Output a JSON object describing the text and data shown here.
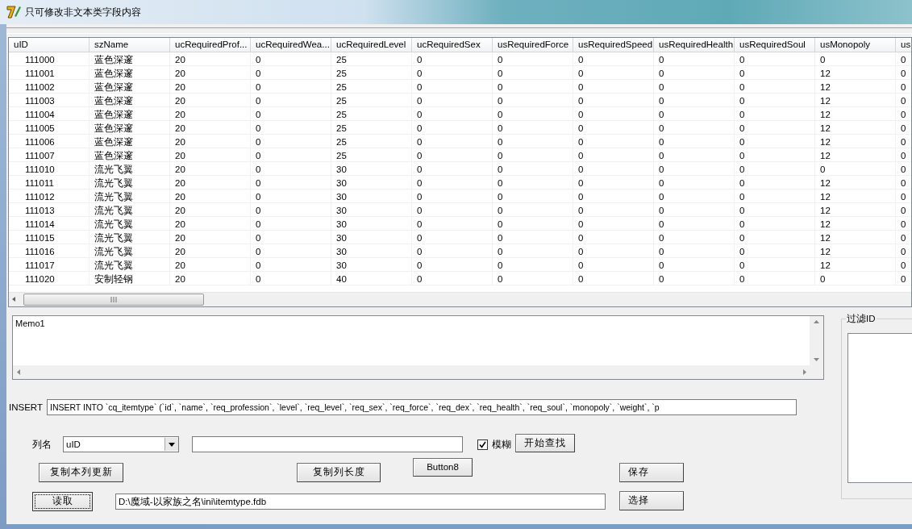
{
  "window": {
    "title": "只可修改非文本类字段内容"
  },
  "table": {
    "columns": [
      "uID",
      "szName",
      "ucRequiredProf...",
      "ucRequiredWea...",
      "ucRequiredLevel",
      "ucRequiredSex",
      "usRequiredForce",
      "usRequiredSpeed",
      "usRequiredHealth",
      "usRequiredSoul",
      "usMonopoly",
      "us"
    ],
    "rows": [
      [
        "111000",
        "蓝色深邃",
        "20",
        "0",
        "25",
        "0",
        "0",
        "0",
        "0",
        "0",
        "0",
        "0"
      ],
      [
        "111001",
        "蓝色深邃",
        "20",
        "0",
        "25",
        "0",
        "0",
        "0",
        "0",
        "0",
        "12",
        "0"
      ],
      [
        "111002",
        "蓝色深邃",
        "20",
        "0",
        "25",
        "0",
        "0",
        "0",
        "0",
        "0",
        "12",
        "0"
      ],
      [
        "111003",
        "蓝色深邃",
        "20",
        "0",
        "25",
        "0",
        "0",
        "0",
        "0",
        "0",
        "12",
        "0"
      ],
      [
        "111004",
        "蓝色深邃",
        "20",
        "0",
        "25",
        "0",
        "0",
        "0",
        "0",
        "0",
        "12",
        "0"
      ],
      [
        "111005",
        "蓝色深邃",
        "20",
        "0",
        "25",
        "0",
        "0",
        "0",
        "0",
        "0",
        "12",
        "0"
      ],
      [
        "111006",
        "蓝色深邃",
        "20",
        "0",
        "25",
        "0",
        "0",
        "0",
        "0",
        "0",
        "12",
        "0"
      ],
      [
        "111007",
        "蓝色深邃",
        "20",
        "0",
        "25",
        "0",
        "0",
        "0",
        "0",
        "0",
        "12",
        "0"
      ],
      [
        "111010",
        "流光飞翼",
        "20",
        "0",
        "30",
        "0",
        "0",
        "0",
        "0",
        "0",
        "0",
        "0"
      ],
      [
        "111011",
        "流光飞翼",
        "20",
        "0",
        "30",
        "0",
        "0",
        "0",
        "0",
        "0",
        "12",
        "0"
      ],
      [
        "111012",
        "流光飞翼",
        "20",
        "0",
        "30",
        "0",
        "0",
        "0",
        "0",
        "0",
        "12",
        "0"
      ],
      [
        "111013",
        "流光飞翼",
        "20",
        "0",
        "30",
        "0",
        "0",
        "0",
        "0",
        "0",
        "12",
        "0"
      ],
      [
        "111014",
        "流光飞翼",
        "20",
        "0",
        "30",
        "0",
        "0",
        "0",
        "0",
        "0",
        "12",
        "0"
      ],
      [
        "111015",
        "流光飞翼",
        "20",
        "0",
        "30",
        "0",
        "0",
        "0",
        "0",
        "0",
        "12",
        "0"
      ],
      [
        "111016",
        "流光飞翼",
        "20",
        "0",
        "30",
        "0",
        "0",
        "0",
        "0",
        "0",
        "12",
        "0"
      ],
      [
        "111017",
        "流光飞翼",
        "20",
        "0",
        "30",
        "0",
        "0",
        "0",
        "0",
        "0",
        "12",
        "0"
      ],
      [
        "111020",
        "安制轻钢",
        "20",
        "0",
        "40",
        "0",
        "0",
        "0",
        "0",
        "0",
        "0",
        "0"
      ]
    ]
  },
  "memo": {
    "value": "Memo1"
  },
  "filter_group": {
    "title": "过滤ID"
  },
  "insert": {
    "label": "INSERT",
    "value": "INSERT INTO `cq_itemtype` (`id`, `name`, `req_profession`, `level`, `req_level`, `req_sex`, `req_force`, `req_dex`, `req_health`, `req_soul`, `monopoly`, `weight`, `p"
  },
  "search": {
    "column_label": "列名",
    "column_value": "uID",
    "fuzzy": {
      "label": "模糊",
      "checked": true
    },
    "button": "开始查找"
  },
  "action_buttons": [
    {
      "label": "复制本列更新"
    },
    {
      "label": "复制列长度"
    },
    {
      "label": "Button8"
    },
    {
      "label": "保存"
    }
  ],
  "file_row": {
    "read_button": "读取",
    "path": "D:\\魔域-以家族之名\\ini\\itemtype.fdb",
    "select_button": "选择"
  }
}
